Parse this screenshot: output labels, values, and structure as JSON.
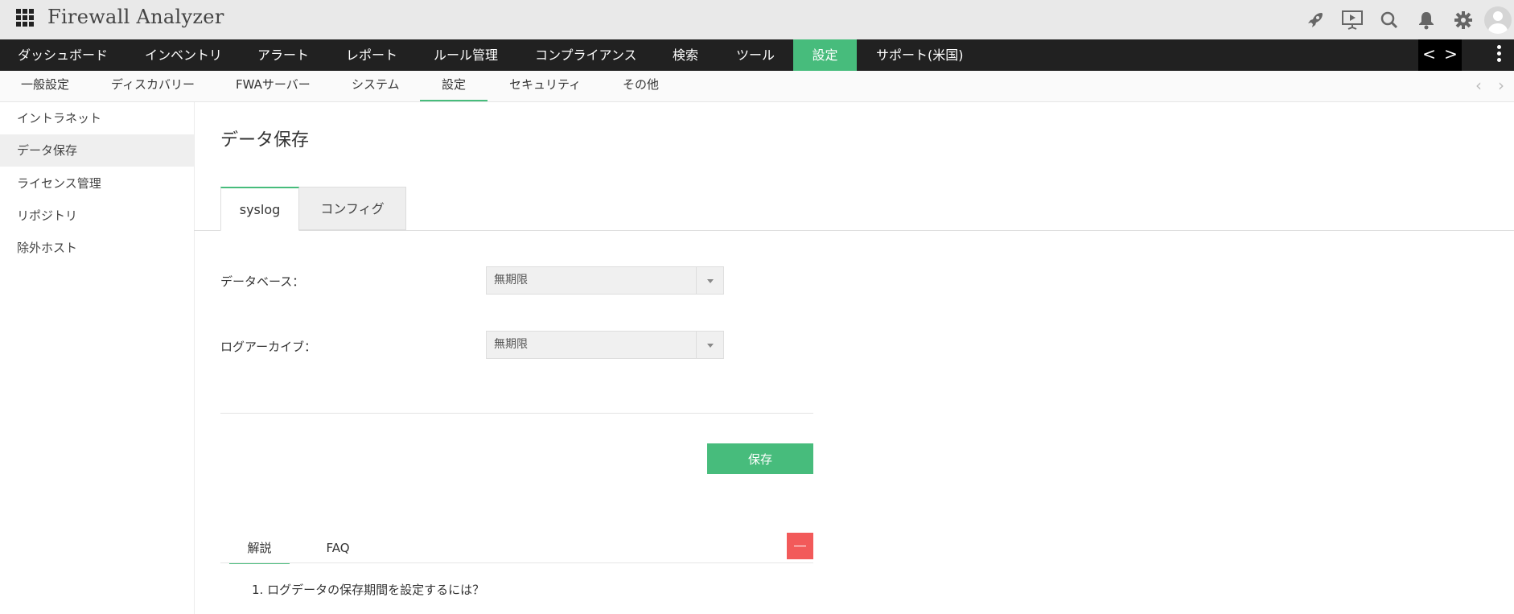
{
  "app": {
    "title": "Firewall Analyzer"
  },
  "topbar_icons": [
    "rocket-icon",
    "presentation-icon",
    "search-icon",
    "bell-icon",
    "gear-icon",
    "avatar"
  ],
  "main_nav": {
    "items": [
      "ダッシュボード",
      "インベントリ",
      "アラート",
      "レポート",
      "ルール管理",
      "コンプライアンス",
      "検索",
      "ツール",
      "設定",
      "サポート(米国)"
    ],
    "active": "設定",
    "prev": "<",
    "next": ">"
  },
  "sub_nav": {
    "items": [
      "一般設定",
      "ディスカバリー",
      "FWAサーバー",
      "システム",
      "設定",
      "セキュリティ",
      "その他"
    ],
    "active": "設定"
  },
  "sidebar": {
    "items": [
      "イントラネット",
      "データ保存",
      "ライセンス管理",
      "リポジトリ",
      "除外ホスト"
    ],
    "active": "データ保存"
  },
  "main": {
    "title": "データ保存",
    "tabs": [
      "syslog",
      "コンフィグ"
    ],
    "active_tab": "syslog",
    "fields": [
      {
        "label": "データベース：",
        "value": "無期限"
      },
      {
        "label": "ログアーカイブ：",
        "value": "無期限"
      }
    ],
    "save_label": "保存"
  },
  "help": {
    "tabs": [
      "解説",
      "FAQ"
    ],
    "active_tab": "解説",
    "collapse_symbol": "—",
    "question": "1. ログデータの保存期間を設定するには？"
  },
  "colors": {
    "accent": "#47bc7c",
    "nav_bg": "#212121",
    "collapse": "#f25a5a"
  }
}
